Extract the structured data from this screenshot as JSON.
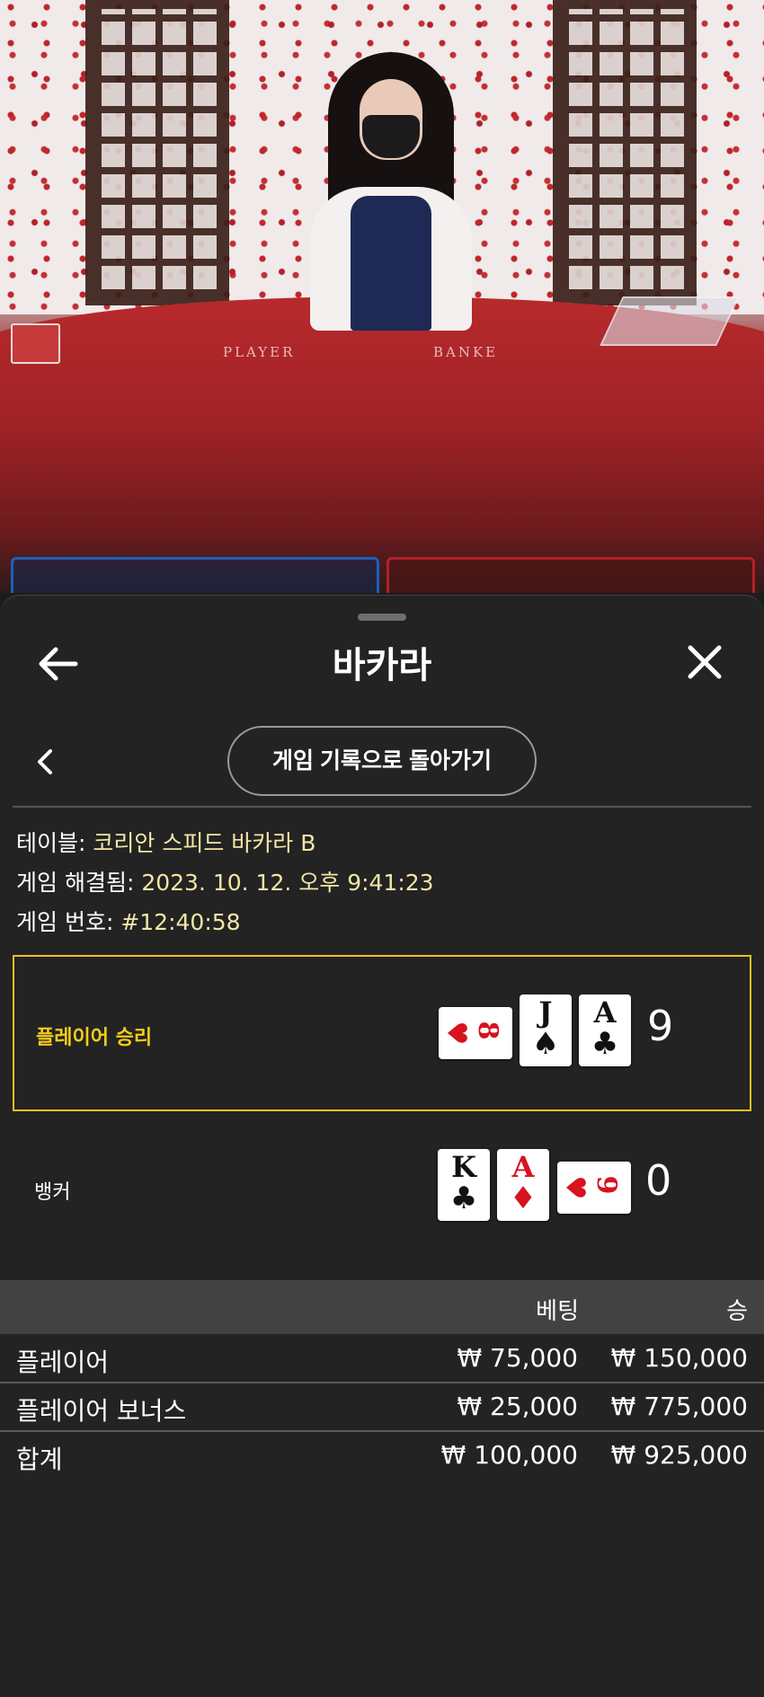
{
  "video": {
    "felt_labels": [
      "PLAYER",
      "BANKE"
    ]
  },
  "sheet": {
    "title": "바카라",
    "back_to_history_label": "게임 기록으로 돌아가기"
  },
  "game_info": {
    "table_label": "테이블:",
    "table_value": "코리안 스피드 바카라 B",
    "resolved_label": "게임 해결됨:",
    "resolved_value": "2023. 10. 12. 오후 9:41:23",
    "number_label": "게임 번호:",
    "number_value": "#12:40:58"
  },
  "hands": {
    "player": {
      "label": "플레이어 승리",
      "score": "9",
      "cards": [
        {
          "rank": "8",
          "suit": "♥",
          "color": "red",
          "orientation": "sideways"
        },
        {
          "rank": "J",
          "suit": "♠",
          "color": "black",
          "orientation": "upright"
        },
        {
          "rank": "A",
          "suit": "♣",
          "color": "black",
          "orientation": "upright"
        }
      ]
    },
    "banker": {
      "label": "뱅커",
      "score": "0",
      "cards": [
        {
          "rank": "K",
          "suit": "♣",
          "color": "black",
          "orientation": "upright"
        },
        {
          "rank": "A",
          "suit": "♦",
          "color": "red",
          "orientation": "upright"
        },
        {
          "rank": "9",
          "suit": "♥",
          "color": "red",
          "orientation": "sideways"
        }
      ]
    }
  },
  "bets_table": {
    "headers": {
      "bet": "베팅",
      "win": "승"
    },
    "rows": [
      {
        "label": "플레이어",
        "bet": "₩ 75,000",
        "win": "₩ 150,000"
      },
      {
        "label": "플레이어 보너스",
        "bet": "₩ 25,000",
        "win": "₩ 775,000"
      },
      {
        "label": "합계",
        "bet": "₩ 100,000",
        "win": "₩ 925,000"
      }
    ]
  },
  "colors": {
    "winner_border": "#e7c31e",
    "winner_text": "#f4cc1c",
    "info_value": "#f2e6a6",
    "player_blue": "#1f5fb8",
    "banker_red": "#b0202a"
  },
  "icons": {
    "back": "arrow-left-icon",
    "close": "close-icon",
    "chevron": "chevron-left-icon"
  }
}
